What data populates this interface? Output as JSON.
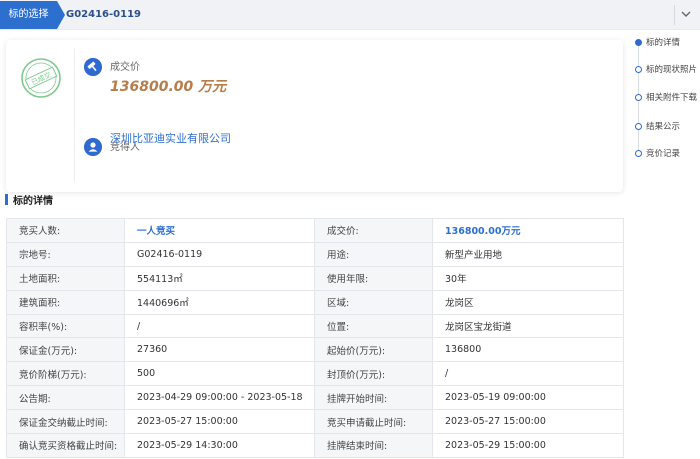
{
  "header": {
    "lot_select_label": "标的选择",
    "lot_select_value": "G02416-0119"
  },
  "deal": {
    "stamp_text": "已成交",
    "price_label": "成交价",
    "price_value": "136800.00 万元",
    "winner_label": "竞得人",
    "winner_value": "深圳比亚迪实业有限公司"
  },
  "toc": {
    "items": [
      {
        "label": "标的详情",
        "active": true
      },
      {
        "label": "标的现状照片",
        "active": false
      },
      {
        "label": "相关附件下载",
        "active": false
      },
      {
        "label": "结果公示",
        "active": false
      },
      {
        "label": "竞价记录",
        "active": false
      }
    ]
  },
  "details": {
    "title": "标的详情",
    "rows": [
      {
        "k1": "竞买人数:",
        "v1": "一人竞买",
        "k2": "成交价:",
        "v2": "136800.00万元"
      },
      {
        "k1": "宗地号:",
        "v1": "G02416-0119",
        "k2": "用途:",
        "v2": "新型产业用地"
      },
      {
        "k1": "土地面积:",
        "v1": "554113㎡",
        "k2": "使用年限:",
        "v2": "30年"
      },
      {
        "k1": "建筑面积:",
        "v1": "1440696㎡",
        "k2": "区域:",
        "v2": "龙岗区"
      },
      {
        "k1": "容积率(%):",
        "v1": "/",
        "k2": "位置:",
        "v2": "龙岗区宝龙街道"
      },
      {
        "k1": "保证金(万元):",
        "v1": "27360",
        "k2": "起始价(万元):",
        "v2": "136800"
      },
      {
        "k1": "竞价阶梯(万元):",
        "v1": "500",
        "k2": "封顶价(万元):",
        "v2": "/"
      },
      {
        "k1": "公告期:",
        "v1": "2023-04-29 09:00:00 - 2023-05-18",
        "k2": "挂牌开始时间:",
        "v2": "2023-05-19 09:00:00"
      },
      {
        "k1": "保证金交纳截止时间:",
        "v1": "2023-05-27 15:00:00",
        "k2": "竞买申请截止时间:",
        "v2": "2023-05-27 15:00:00"
      },
      {
        "k1": "确认竞买资格截止时间:",
        "v1": "2023-05-29 14:30:00",
        "k2": "挂牌结束时间:",
        "v2": "2023-05-29 15:00:00"
      }
    ]
  },
  "colors": {
    "accent": "#2d6fcf",
    "price": "#b87c48",
    "stamp": "#7fc98f"
  },
  "icons": {
    "dropdown": "chevron-down-icon",
    "price": "gavel-icon",
    "winner": "user-icon",
    "stamp": "deal-stamp-icon"
  }
}
